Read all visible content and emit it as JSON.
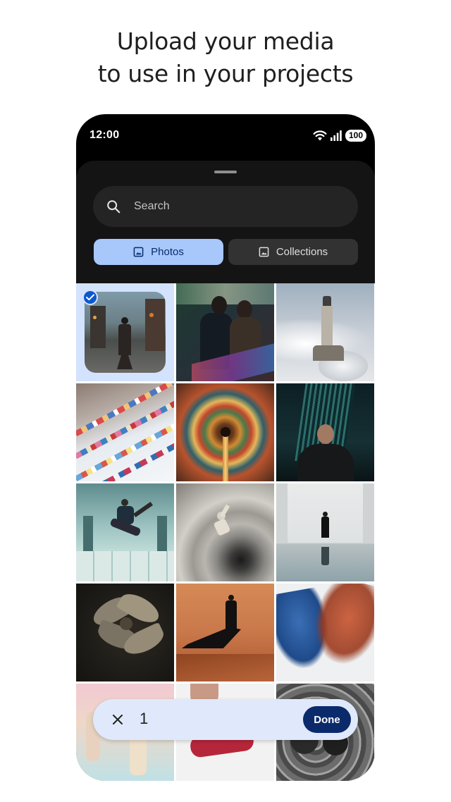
{
  "headline": {
    "line1": "Upload your media",
    "line2": "to use in your projects"
  },
  "status_bar": {
    "time": "12:00",
    "battery": "100",
    "icons": [
      "wifi-icon",
      "signal-icon",
      "battery-icon"
    ]
  },
  "picker": {
    "search": {
      "placeholder": "Search",
      "value": ""
    },
    "tabs": [
      {
        "label": "Photos",
        "icon": "image-icon",
        "selected": true
      },
      {
        "label": "Collections",
        "icon": "image-icon",
        "selected": false
      }
    ],
    "photos": [
      {
        "subject": "person-walking-rainy-street",
        "selected": true
      },
      {
        "subject": "couple-neon-store",
        "selected": false
      },
      {
        "subject": "lighthouse-above-clouds",
        "selected": false
      },
      {
        "subject": "hanging-laundry-lines",
        "selected": false
      },
      {
        "subject": "kaleidoscope-lights-ceiling",
        "selected": false
      },
      {
        "subject": "man-skyscraper-night",
        "selected": false
      },
      {
        "subject": "dancer-jumping-hall",
        "selected": false
      },
      {
        "subject": "spiral-staircase-person",
        "selected": false
      },
      {
        "subject": "person-white-room-reflection",
        "selected": false
      },
      {
        "subject": "lily-flower",
        "selected": false
      },
      {
        "subject": "woman-desert-dunes",
        "selected": false
      },
      {
        "subject": "flowing-fabric-blue-red",
        "selected": false
      },
      {
        "subject": "pastel-figures",
        "selected": false
      },
      {
        "subject": "hand-dancer-red",
        "selected": false
      },
      {
        "subject": "cobblestone-bw",
        "selected": false
      }
    ]
  },
  "selection_bar": {
    "count": "1",
    "done_label": "Done",
    "close_icon": "close-icon"
  },
  "colors": {
    "accent": "#a8c7fa",
    "done_button": "#0b2a6b",
    "selection_bg": "#d3e3fd",
    "sheet_bg": "#141414"
  }
}
